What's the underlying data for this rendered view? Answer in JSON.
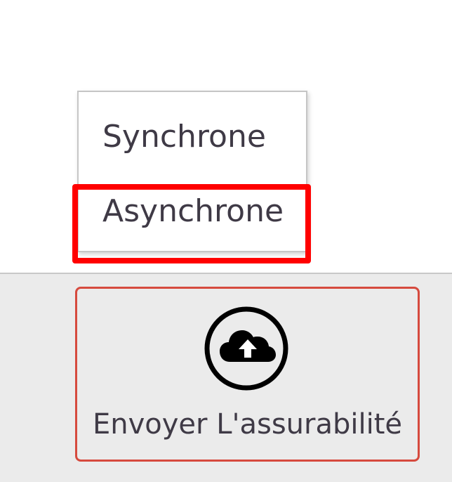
{
  "dropdown": {
    "items": [
      {
        "label": "Synchrone"
      },
      {
        "label": "Asynchrone"
      }
    ],
    "highlighted_item": "Asynchrone"
  },
  "toolbar": {
    "upload_button_label": "Envoyer L'assurabilité",
    "upload_icon": "cloud-upload-icon"
  },
  "colors": {
    "highlight": "#ff0000",
    "button_border": "#d64a3e",
    "toolbar_background": "#ebebeb",
    "text": "#3f3a46"
  }
}
